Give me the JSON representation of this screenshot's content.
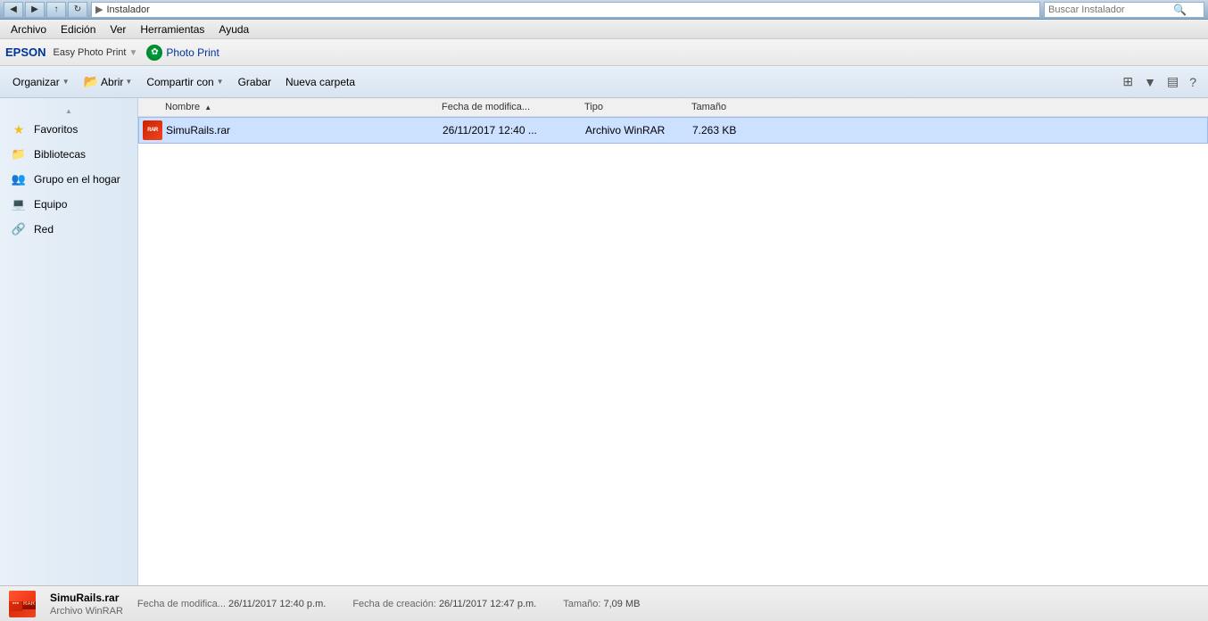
{
  "titlebar": {
    "path_label": "Instalador",
    "search_placeholder": "Buscar Instalador"
  },
  "menubar": {
    "items": [
      {
        "id": "archivo",
        "label": "Archivo"
      },
      {
        "id": "edicion",
        "label": "Edición"
      },
      {
        "id": "ver",
        "label": "Ver"
      },
      {
        "id": "herramientas",
        "label": "Herramientas"
      },
      {
        "id": "ayuda",
        "label": "Ayuda"
      }
    ]
  },
  "toolbar": {
    "epson_label": "EPSON",
    "app_label": "Easy Photo Print",
    "photo_print_label": "Photo Print"
  },
  "action_toolbar": {
    "organizar_label": "Organizar",
    "abrir_label": "Abrir",
    "compartir_label": "Compartir con",
    "grabar_label": "Grabar",
    "nueva_carpeta_label": "Nueva carpeta"
  },
  "columns": {
    "name": "Nombre",
    "date": "Fecha de modifica...",
    "type": "Tipo",
    "size": "Tamaño"
  },
  "sidebar": {
    "items": [
      {
        "id": "favoritos",
        "label": "Favoritos",
        "icon": "★"
      },
      {
        "id": "bibliotecas",
        "label": "Bibliotecas",
        "icon": "📚"
      },
      {
        "id": "grupo-hogar",
        "label": "Grupo en el hogar",
        "icon": "👥"
      },
      {
        "id": "equipo",
        "label": "Equipo",
        "icon": "💻"
      },
      {
        "id": "red",
        "label": "Red",
        "icon": "🔗"
      }
    ]
  },
  "files": [
    {
      "name": "SimuRails.rar",
      "date": "26/11/2017 12:40 ...",
      "type": "Archivo WinRAR",
      "size": "7.263 KB",
      "selected": true
    }
  ],
  "statusbar": {
    "filename": "SimuRails.rar",
    "filetype": "Archivo WinRAR",
    "date_modified_label": "Fecha de modifica...",
    "date_modified": "26/11/2017 12:40 p.m.",
    "date_created_label": "Fecha de creación:",
    "date_created": "26/11/2017 12:47 p.m.",
    "size_label": "Tamaño:",
    "size": "7,09 MB"
  }
}
